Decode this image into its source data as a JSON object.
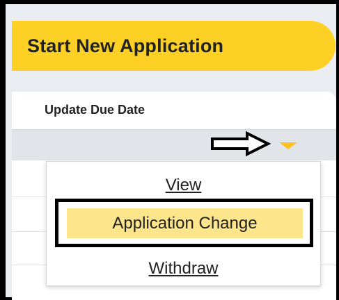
{
  "toolbar": {
    "start_new_application_label": "Start New Application"
  },
  "table": {
    "column_header": "Update Due Date"
  },
  "actions_menu": {
    "items": [
      {
        "label": "View",
        "link": true
      },
      {
        "label": "Application Change",
        "highlighted": true
      },
      {
        "label": "Withdraw",
        "link": true
      }
    ]
  },
  "annotation": {
    "icon": "hollow-right-arrow-icon"
  },
  "colors": {
    "accent_yellow": "#fdd025",
    "highlight_yellow": "#fde58c",
    "caret_yellow": "#fdc121",
    "row_gray": "#e1e5ea",
    "background_gray": "#e9ecf0"
  }
}
